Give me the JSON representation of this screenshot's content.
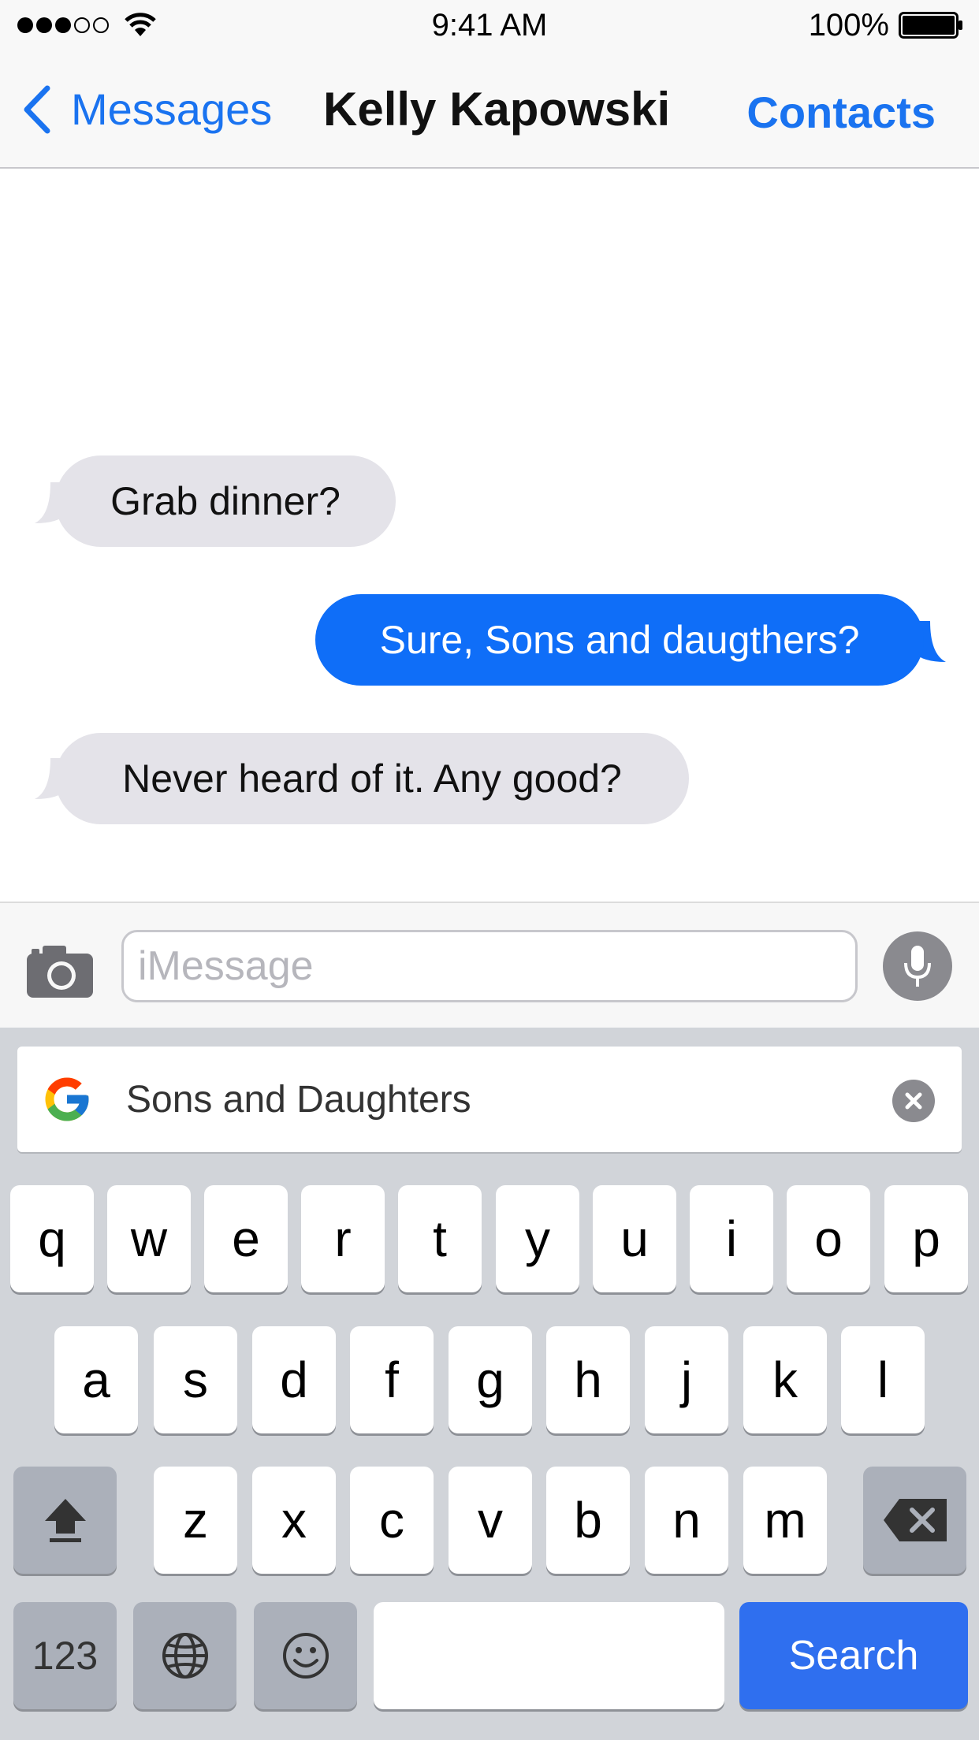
{
  "status_bar": {
    "time": "9:41 AM",
    "battery_percent": "100%",
    "signal_strength_dots": 3,
    "signal_total_dots": 5,
    "icons": [
      "wifi-icon",
      "battery-icon"
    ]
  },
  "nav": {
    "back_label": "Messages",
    "title": "Kelly Kapowski",
    "contacts_label": "Contacts",
    "back_icon": "chevron-left-icon"
  },
  "messages": [
    {
      "direction": "incoming",
      "text": "Grab dinner?"
    },
    {
      "direction": "outgoing",
      "text": "Sure, Sons and daugthers?"
    },
    {
      "direction": "incoming",
      "text": "Never heard of it. Any good?"
    }
  ],
  "compose": {
    "placeholder": "iMessage",
    "value": "",
    "camera_icon": "camera-icon",
    "mic_icon": "microphone-icon"
  },
  "suggestion": {
    "text": "Sons and Daughters",
    "icon": "google-logo-icon",
    "clear_icon": "clear-icon"
  },
  "keyboard": {
    "row1": [
      "q",
      "w",
      "e",
      "r",
      "t",
      "y",
      "u",
      "i",
      "o",
      "p"
    ],
    "row2": [
      "a",
      "s",
      "d",
      "f",
      "g",
      "h",
      "j",
      "k",
      "l"
    ],
    "row3": [
      "z",
      "x",
      "c",
      "v",
      "b",
      "n",
      "m"
    ],
    "numbers_label": "123",
    "space_label": "",
    "search_label": "Search"
  },
  "colors": {
    "accent": "#1a73f0",
    "outgoing_bubble": "#0f6ef8",
    "incoming_bubble": "#e4e3e9",
    "keyboard_bg": "#d1d4d9",
    "search_key": "#2f6fef"
  }
}
